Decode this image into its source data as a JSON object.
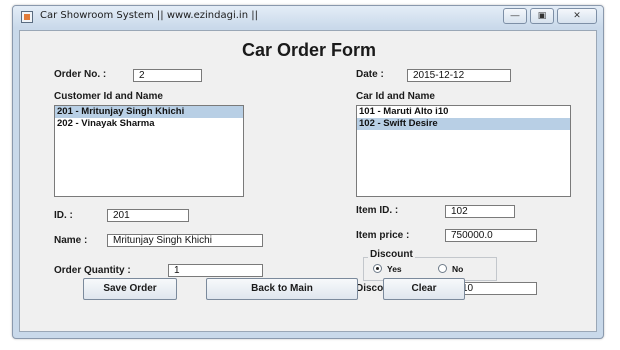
{
  "window": {
    "title": "Car Showroom System || www.ezindagi.in ||",
    "minimize_glyph": "―",
    "maximize_glyph": "▣",
    "close_glyph": "✕"
  },
  "form": {
    "title": "Car Order Form",
    "order_no_label": "Order No. :",
    "order_no_value": "2",
    "date_label": "Date :",
    "date_value": "2015-12-12",
    "customer_list_label": "Customer Id and Name",
    "customers": [
      {
        "text": "201 - Mritunjay Singh Khichi",
        "selected": true
      },
      {
        "text": "202 - Vinayak Sharma",
        "selected": false
      }
    ],
    "car_list_label": "Car Id and Name",
    "cars": [
      {
        "text": "101 - Maruti Alto i10",
        "selected": false
      },
      {
        "text": "102 - Swift Desire",
        "selected": true
      }
    ],
    "id_label": "ID. :",
    "id_value": "201",
    "item_id_label": "Item ID. :",
    "item_id_value": "102",
    "name_label": "Name :",
    "name_value": "Mritunjay Singh Khichi",
    "item_price_label": "Item price :",
    "item_price_value": "750000.0",
    "discount_group_label": "Discount",
    "discount_yes_label": "Yes",
    "discount_no_label": "No",
    "discount_selected": "Yes",
    "order_quantity_label": "Order Quantity :",
    "order_quantity_value": "1",
    "discount_pct_label": "Discount (%) :",
    "discount_pct_value": "10"
  },
  "buttons": {
    "save": "Save Order",
    "back": "Back to Main",
    "clear": "Clear"
  }
}
